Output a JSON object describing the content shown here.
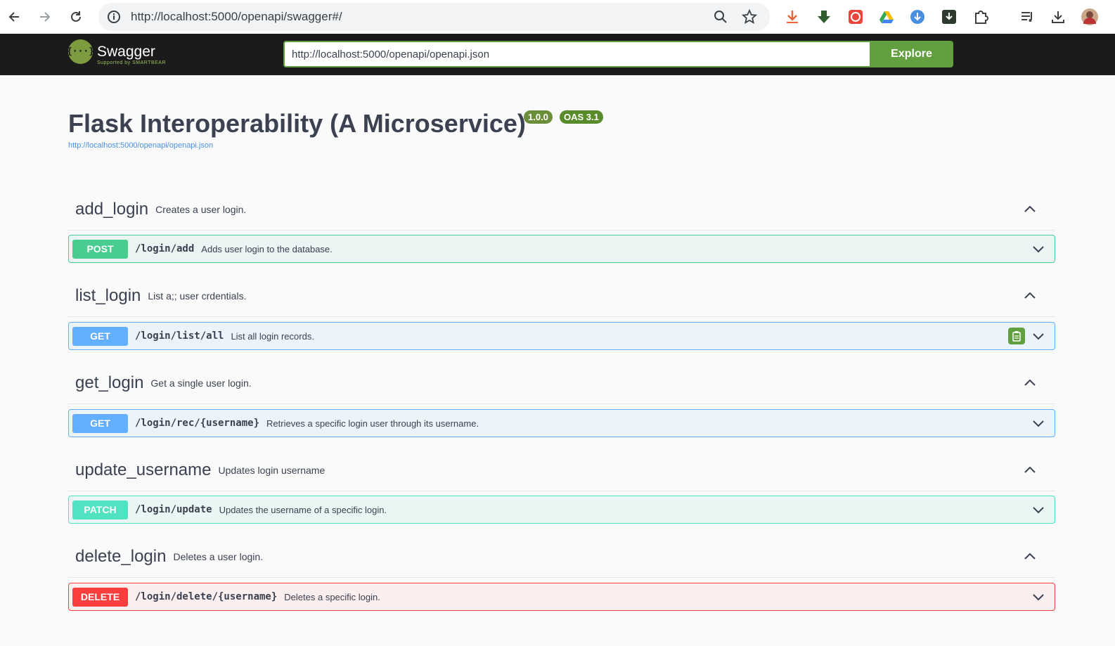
{
  "browser": {
    "url": "http://localhost:5000/openapi/swagger#/"
  },
  "topbar": {
    "logo_text": "Swagger",
    "logo_sub": "Supported by SMARTBEAR",
    "spec_url": "http://localhost:5000/openapi/openapi.json",
    "explore_label": "Explore"
  },
  "info": {
    "title": "Flask Interoperability (A Microservice)",
    "version": "1.0.0",
    "oas": "OAS 3.1",
    "link": "http://localhost:5000/openapi/openapi.json"
  },
  "tags": [
    {
      "name": "add_login",
      "description": "Creates a user login."
    },
    {
      "name": "list_login",
      "description": "List a;; user crdentials."
    },
    {
      "name": "get_login",
      "description": "Get a single user login."
    },
    {
      "name": "update_username",
      "description": "Updates login username"
    },
    {
      "name": "delete_login",
      "description": "Deletes a user login."
    }
  ],
  "operations": [
    {
      "method": "POST",
      "path": "/login/add",
      "summary": "Adds user login to the database."
    },
    {
      "method": "GET",
      "path": "/login/list/all",
      "summary": "List all login records."
    },
    {
      "method": "GET",
      "path": "/login/rec/{username}",
      "summary": "Retrieves a specific login user through its username."
    },
    {
      "method": "PATCH",
      "path": "/login/update",
      "summary": "Updates the username of a specific login."
    },
    {
      "method": "DELETE",
      "path": "/login/delete/{username}",
      "summary": "Deletes a specific login."
    }
  ],
  "colors": {
    "post": "#49cc90",
    "get": "#61affe",
    "patch": "#50e3c2",
    "delete": "#f93e3e",
    "swagger_green": "#62a03f"
  }
}
